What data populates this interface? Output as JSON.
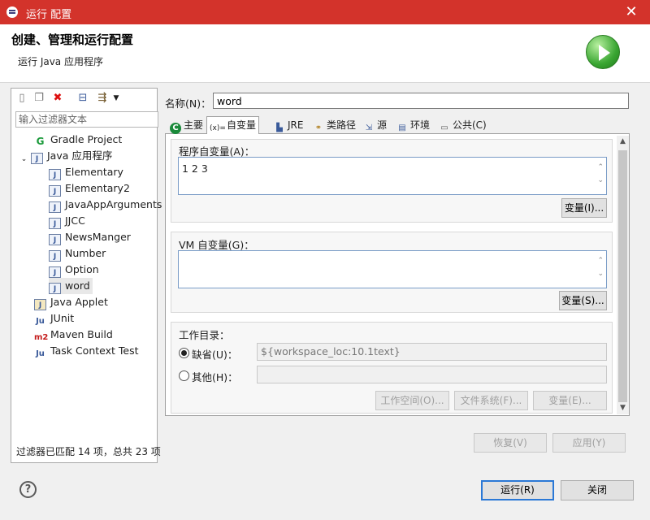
{
  "window": {
    "title": "运行 配置",
    "close": "✕"
  },
  "header": {
    "title": "创建、管理和运行配置",
    "subtitle": "运行 Java 应用程序"
  },
  "toolbar": {
    "new_icon": "new-config-icon",
    "duplicate_icon": "duplicate-icon",
    "delete_icon": "delete-icon",
    "collapse_icon": "collapse-all-icon",
    "filter_icon": "filter-icon",
    "dropdown_icon": "chevron-down-icon"
  },
  "filter": {
    "placeholder": "输入过滤器文本"
  },
  "tree": {
    "gradle": "Gradle Project",
    "java_app": "Java 应用程序",
    "children": [
      "Elementary",
      "Elementary2",
      "JavaAppArguments",
      "JJCC",
      "NewsManger",
      "Number",
      "Option",
      "word"
    ],
    "applet": "Java Applet",
    "junit": "JUnit",
    "maven": "Maven Build",
    "task": "Task Context Test"
  },
  "filter_summary": "过滤器已匹配 14 项，总共 23 项",
  "config": {
    "name_label": "名称(N)：",
    "name_value": "word",
    "tabs": [
      {
        "label": "主要",
        "icon": "main-tab-icon"
      },
      {
        "label": "自变量",
        "icon": "arguments-icon"
      },
      {
        "label": "JRE",
        "icon": "jre-icon"
      },
      {
        "label": "类路径",
        "icon": "classpath-icon"
      },
      {
        "label": "源",
        "icon": "source-icon"
      },
      {
        "label": "环境",
        "icon": "environment-icon"
      },
      {
        "label": "公共(C)",
        "icon": "common-icon"
      }
    ],
    "active_tab": "自变量",
    "program_args": {
      "label": "程序自变量(A)：",
      "value": "1 2 3",
      "button": "变量(I)..."
    },
    "vm_args": {
      "label": "VM 自变量(G)：",
      "value": "",
      "button": "变量(S)..."
    },
    "working_dir": {
      "label": "工作目录：",
      "default_label": "缺省(U)：",
      "default_value": "${workspace_loc:10.1text}",
      "other_label": "其他(H)：",
      "other_value": "",
      "selected": "default",
      "buttons": {
        "workspace": "工作空间(O)...",
        "filesystem": "文件系统(F)...",
        "variables": "变量(E)..."
      }
    },
    "revert_button": "恢复(V)",
    "apply_button": "应用(Y)"
  },
  "footer": {
    "run_button": "运行(R)",
    "close_button": "关闭",
    "help_icon": "help-icon",
    "help_glyph": "?"
  }
}
